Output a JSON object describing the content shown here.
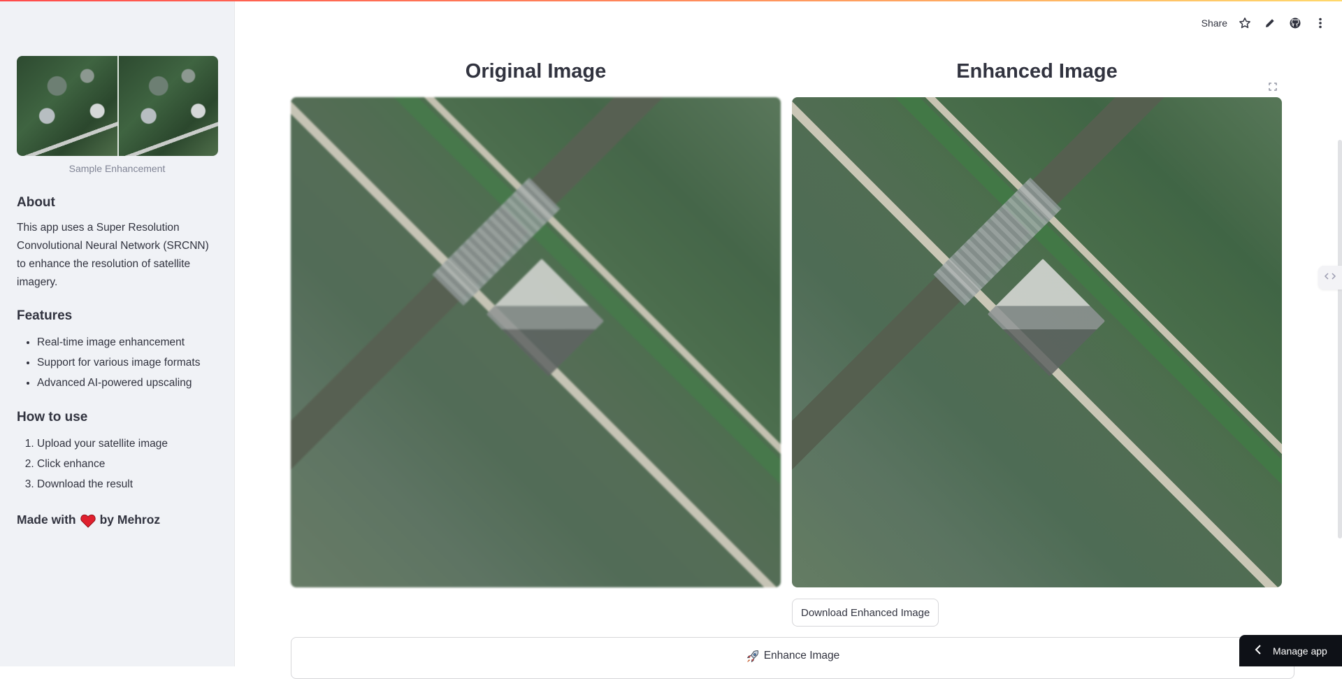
{
  "sidebar": {
    "sample_caption": "Sample Enhancement",
    "about_heading": "About",
    "about_text": "This app uses a Super Resolution Convolutional Neural Network (SRCNN) to enhance the resolution of satellite imagery.",
    "features_heading": "Features",
    "features": [
      "Real-time image enhancement",
      "Support for various image formats",
      "Advanced AI-powered upscaling"
    ],
    "howto_heading": "How to use",
    "steps": [
      "Upload your satellite image",
      "Click enhance",
      "Download the result"
    ],
    "made_with_prefix": "Made with",
    "made_with_suffix": "by Mehroz"
  },
  "toolbar": {
    "share_label": "Share",
    "icons": [
      "star-icon",
      "edit-pencil-icon",
      "github-icon",
      "more-vertical-icon"
    ]
  },
  "main": {
    "original_title": "Original Image",
    "enhanced_title": "Enhanced Image",
    "download_label": "Download Enhanced Image",
    "enhance_label": "Enhance Image",
    "enhance_icon": "rocket-icon"
  },
  "manage_app": {
    "label": "Manage app"
  },
  "colors": {
    "sidebar_bg": "#f0f2f6",
    "text": "#31333f",
    "accent": "#ff4b4b",
    "manage_bg": "#0e1117",
    "heart": "#e0202e"
  }
}
